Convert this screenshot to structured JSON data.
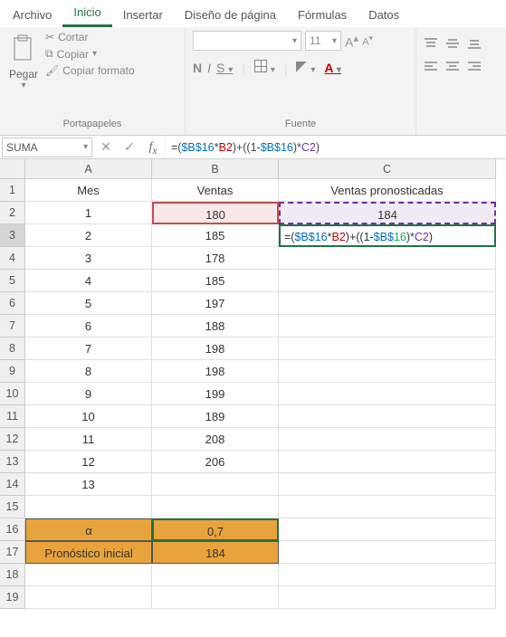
{
  "tabs": [
    "Archivo",
    "Inicio",
    "Insertar",
    "Diseño de página",
    "Fórmulas",
    "Datos"
  ],
  "activeTab": 1,
  "ribbon": {
    "paste_label": "Pegar",
    "cut": "Cortar",
    "copy": "Copiar",
    "format_painter": "Copiar formato",
    "portapapeles": "Portapapeles",
    "font_size": "11",
    "bold": "N",
    "italic": "I",
    "underline": "S",
    "fuente": "Fuente",
    "font_large": "A",
    "font_small": "A"
  },
  "formula_bar": {
    "namebox": "SUMA",
    "formula_plain": "=($B$16*B2)+((1-$B$16)*C2)",
    "tokens": [
      {
        "t": "=(",
        "c": ""
      },
      {
        "t": "$B$16",
        "c": "ft-b"
      },
      {
        "t": "*",
        "c": ""
      },
      {
        "t": "B2",
        "c": "ft-r"
      },
      {
        "t": ")+",
        "c": ""
      },
      {
        "t": "((1-",
        "c": ""
      },
      {
        "t": "$B$16",
        "c": "ft-b"
      },
      {
        "t": ")*",
        "c": ""
      },
      {
        "t": "C2",
        "c": "ft-p"
      },
      {
        "t": ")",
        "c": ""
      }
    ]
  },
  "columns": [
    "A",
    "B",
    "C"
  ],
  "headers": {
    "A": "Mes",
    "B": "Ventas",
    "C": "Ventas pronosticadas"
  },
  "mes": [
    "1",
    "2",
    "3",
    "4",
    "5",
    "6",
    "7",
    "8",
    "9",
    "10",
    "11",
    "12",
    "13"
  ],
  "ventas": [
    "180",
    "185",
    "178",
    "185",
    "197",
    "188",
    "198",
    "198",
    "199",
    "189",
    "208",
    "206",
    ""
  ],
  "c2": "184",
  "edit_tokens": [
    {
      "t": "=(",
      "c": ""
    },
    {
      "t": "$B$16",
      "c": "ft-b"
    },
    {
      "t": "*",
      "c": ""
    },
    {
      "t": "B2",
      "c": "ft-r"
    },
    {
      "t": ")+((1-",
      "c": ""
    },
    {
      "t": "$B$",
      "c": "ft-b"
    },
    {
      "t": "16",
      "c": "ft-g"
    },
    {
      "t": ")*",
      "c": ""
    },
    {
      "t": "C2",
      "c": "ft-p"
    },
    {
      "t": ")",
      "c": ""
    }
  ],
  "row16": {
    "A": "α",
    "B": "0,7"
  },
  "row17": {
    "A": "Pronóstico inicial",
    "B": "184"
  },
  "row_count": 19
}
